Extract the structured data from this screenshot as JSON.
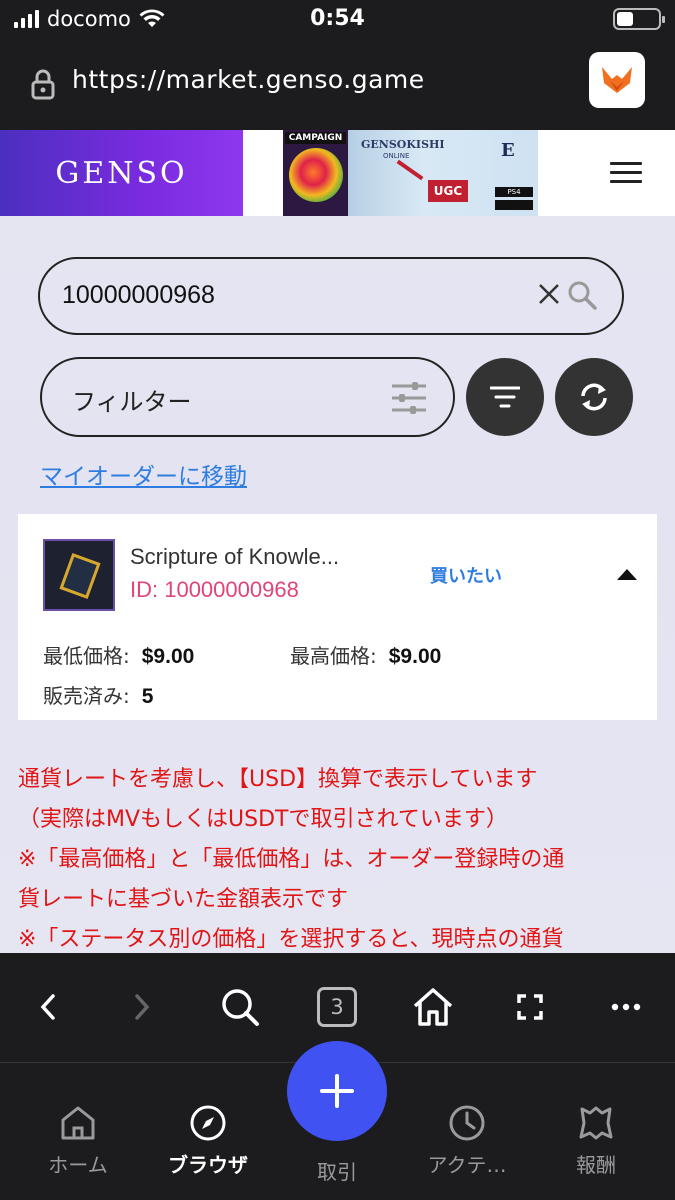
{
  "status_bar": {
    "carrier": "docomo",
    "time": "0:54"
  },
  "browser": {
    "url": "https://market.genso.game",
    "open_tabs": "3"
  },
  "site": {
    "logo": "GENSO",
    "banner": {
      "badge": "CAMPAIGN",
      "title": "GENSOKISHI",
      "subtitle": "ONLINE",
      "tag": "UGC",
      "platform": "PS4",
      "corner_text": "E"
    }
  },
  "search": {
    "value": "10000000968"
  },
  "filter": {
    "label": "フィルター"
  },
  "my_order_link": "マイオーダーに移動",
  "item": {
    "name": "Scripture of Knowle...",
    "id_text": "ID: 10000000968",
    "status": "買いたい",
    "min_price_label": "最低価格:",
    "min_price": "$9.00",
    "max_price_label": "最高価格:",
    "max_price": "$9.00",
    "sold_label": "販売済み:",
    "sold": "5"
  },
  "notice_lines": [
    "通貨レートを考慮し、【USD】換算で表示しています",
    "（実際はMVもしくはUSDTで取引されています）",
    "※「最高価格」と「最低価格」は、オーダー登録時の通",
    "貨レートに基づいた金額表示です",
    "※「ステータス別の価格」を選択すると、現時点の通貨"
  ],
  "tabbar": {
    "home": "ホーム",
    "browser": "ブラウザ",
    "trade": "取引",
    "activity": "アクテ…",
    "rewards": "報酬"
  },
  "colors": {
    "accent_blue": "#4053f2",
    "link_blue": "#2f7de0",
    "notice_red": "#e01515",
    "id_pink": "#e0447a",
    "logo_purple": "#7b2be0"
  }
}
